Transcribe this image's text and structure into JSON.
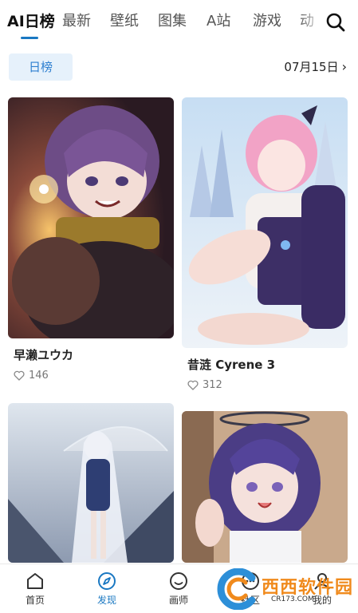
{
  "tabs": [
    {
      "label": "AI日榜",
      "active": true
    },
    {
      "label": "最新"
    },
    {
      "label": "壁纸"
    },
    {
      "label": "图集"
    },
    {
      "label": "A站"
    },
    {
      "label": "游戏"
    },
    {
      "label": "动"
    }
  ],
  "accent_color": "#1a78c2",
  "filter": {
    "label": "日榜",
    "date": "07月15日"
  },
  "cards": [
    {
      "title": "早濑ユウカ",
      "likes": "146"
    },
    {
      "title": "昔涟 Cyrene 3",
      "likes": "312"
    },
    {
      "title": "",
      "likes": ""
    },
    {
      "title": "",
      "likes": ""
    }
  ],
  "nav": [
    {
      "label": "首页",
      "icon": "home-icon"
    },
    {
      "label": "发现",
      "icon": "compass-icon",
      "active": true
    },
    {
      "label": "画师",
      "icon": "smile-icon"
    },
    {
      "label": "社区",
      "icon": "chat-icon"
    },
    {
      "label": "我的",
      "icon": "user-icon"
    }
  ],
  "watermark": {
    "text": "西西软件园",
    "sub": "CR173.COM"
  }
}
